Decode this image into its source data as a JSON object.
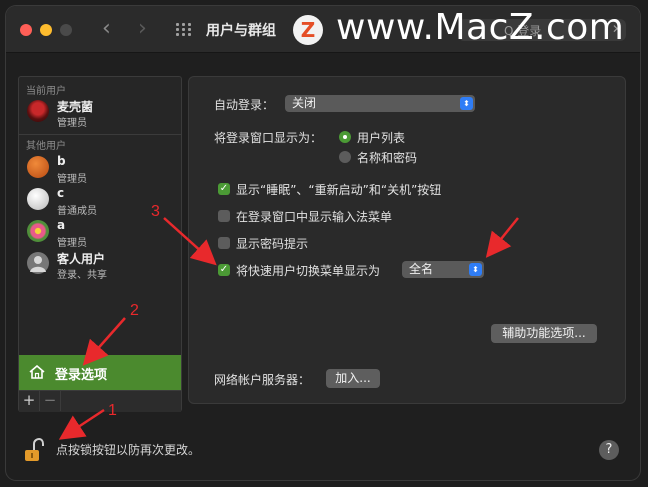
{
  "window": {
    "title": "用户与群组",
    "search_placeholder": "Q 登录",
    "watermark": "www.MacZ.com",
    "logo_letter": "Z"
  },
  "users_panel": {
    "current_header": "当前用户",
    "others_header": "其他用户",
    "current_user": {
      "name": "麦壳菌",
      "role": "管理员"
    },
    "other_users": [
      {
        "name": "b",
        "role": "管理员",
        "avatar": "basketball"
      },
      {
        "name": "c",
        "role": "普通成员",
        "avatar": "golf-ball"
      },
      {
        "name": "a",
        "role": "管理员",
        "avatar": "flower"
      },
      {
        "name": "客人用户",
        "role": "登录、共享",
        "avatar": "guest-silhouette"
      }
    ],
    "login_options_label": "登录选项",
    "add_symbol": "+",
    "remove_symbol": "−"
  },
  "options": {
    "auto_login_label": "自动登录：",
    "auto_login_value": "关闭",
    "display_as_label": "将登录窗口显示为：",
    "radio_user_list": "用户列表",
    "radio_name_password": "名称和密码",
    "cb_sleep_restart": "显示“睡眠”、“重新启动”和“关机”按钮",
    "cb_input_menu": "在登录窗口中显示输入法菜单",
    "cb_password_hints": "显示密码提示",
    "cb_fast_switch": "将快速用户切换菜单显示为",
    "fast_switch_value": "全名",
    "accessibility_button": "辅助功能选项...",
    "network_server_label": "网络帐户服务器：",
    "join_button": "加入..."
  },
  "footer": {
    "lock_text": "点按锁按钮以防再次更改。",
    "help_symbol": "?"
  },
  "annotations": {
    "n1": "1",
    "n2": "2",
    "n3": "3"
  },
  "colors": {
    "accent_green": "#4b9a35",
    "selection_green": "#4b8a2e",
    "popup_blue": "#2f7df6",
    "annotation_red": "#e8292c"
  }
}
